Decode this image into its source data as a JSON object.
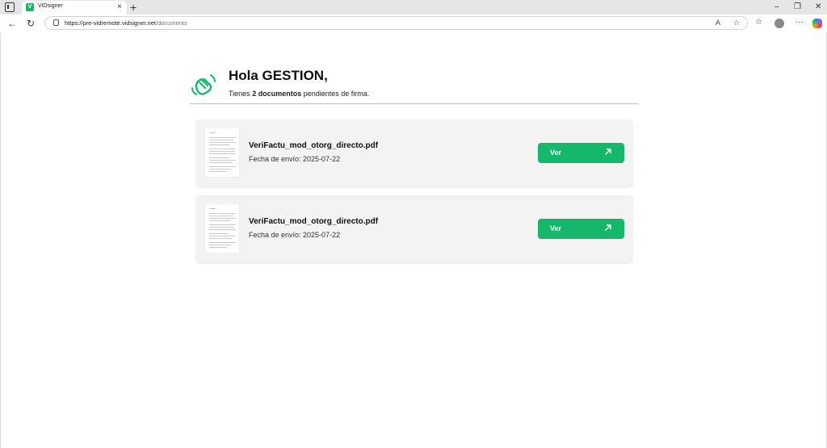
{
  "browser": {
    "tab_title": "VIDsigner",
    "favicon_letter": "V",
    "tab_close": "×",
    "new_tab": "+",
    "url_host": "https://pre-vidremote.vidsigner.net",
    "url_path": "/documents",
    "window_minimize": "–",
    "window_restore": "❐",
    "window_close": "✕"
  },
  "greeting": {
    "title": "Hola GESTION,",
    "sub_prefix": "Tienes ",
    "sub_bold": "2 documentos",
    "sub_suffix": " pendientes de firma."
  },
  "documents": [
    {
      "name": "VeriFactu_mod_otorg_directo.pdf",
      "date": "Fecha de envío: 2025-07-22",
      "button": "Ver"
    },
    {
      "name": "VeriFactu_mod_otorg_directo.pdf",
      "date": "Fecha de envío: 2025-07-22",
      "button": "Ver"
    }
  ],
  "colors": {
    "accent": "#15b86a"
  }
}
